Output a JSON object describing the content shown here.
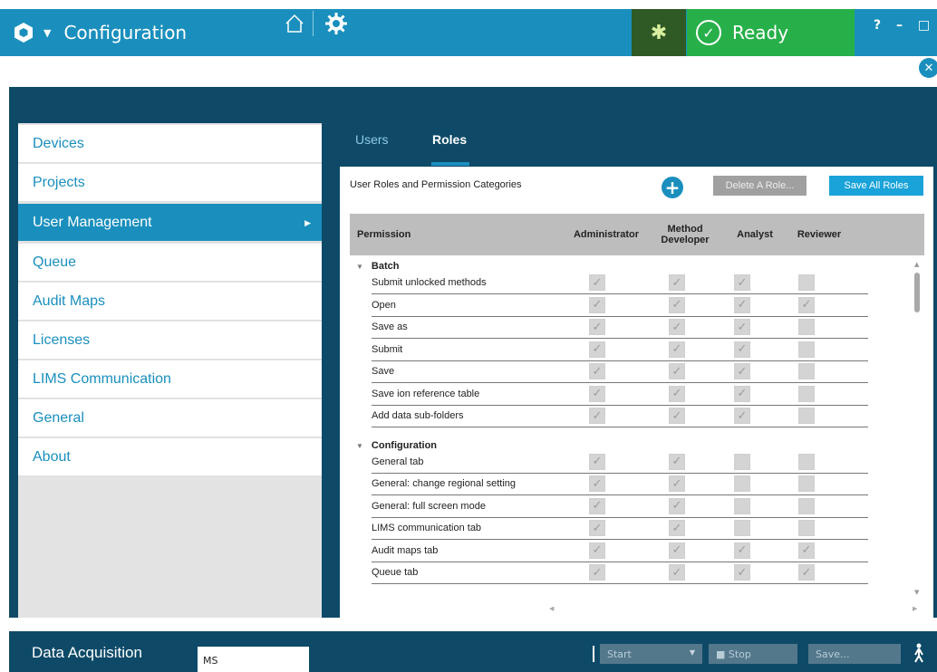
{
  "app": {
    "title": "Configuration",
    "status": "Ready",
    "window_controls": "? – □ ✕"
  },
  "colors": {
    "primary": "#1a8fbd",
    "dark": "#0e4a68",
    "ready": "#27b04a"
  },
  "sidebar": {
    "items": [
      {
        "label": "Devices"
      },
      {
        "label": "Projects"
      },
      {
        "label": "User Management",
        "active": true
      },
      {
        "label": "Queue"
      },
      {
        "label": "Audit Maps"
      },
      {
        "label": "Licenses"
      },
      {
        "label": "LIMS Communication"
      },
      {
        "label": "General"
      },
      {
        "label": "About"
      }
    ]
  },
  "tabs": [
    {
      "label": "Users"
    },
    {
      "label": "Roles",
      "active": true
    }
  ],
  "roles": {
    "title": "User Roles and Permission Categories",
    "add_icon": "plus-circle-icon",
    "delete_label": "Delete A Role...",
    "save_label": "Save All Roles",
    "columns": [
      "Permission",
      "Administrator",
      "Method Developer",
      "Analyst",
      "Reviewer"
    ],
    "groups": [
      {
        "name": "Batch",
        "rows": [
          {
            "label": "Submit unlocked methods",
            "checks": [
              true,
              true,
              true,
              false
            ]
          },
          {
            "label": "Open",
            "checks": [
              true,
              true,
              true,
              true
            ]
          },
          {
            "label": "Save as",
            "checks": [
              true,
              true,
              true,
              false
            ]
          },
          {
            "label": "Submit",
            "checks": [
              true,
              true,
              true,
              false
            ]
          },
          {
            "label": "Save",
            "checks": [
              true,
              true,
              true,
              false
            ]
          },
          {
            "label": "Save ion reference table",
            "checks": [
              true,
              true,
              true,
              false
            ]
          },
          {
            "label": "Add data sub-folders",
            "checks": [
              true,
              true,
              true,
              false
            ]
          }
        ]
      },
      {
        "name": "Configuration",
        "rows": [
          {
            "label": "General tab",
            "checks": [
              true,
              true,
              false,
              false
            ]
          },
          {
            "label": "General: change regional setting",
            "checks": [
              true,
              true,
              false,
              false
            ]
          },
          {
            "label": "General: full screen mode",
            "checks": [
              true,
              true,
              false,
              false
            ]
          },
          {
            "label": "LIMS communication tab",
            "checks": [
              true,
              true,
              false,
              false
            ]
          },
          {
            "label": "Audit maps tab",
            "checks": [
              true,
              true,
              true,
              true
            ]
          },
          {
            "label": "Queue tab",
            "checks": [
              true,
              true,
              true,
              true
            ]
          }
        ]
      }
    ]
  },
  "bottom": {
    "title": "Data Acquisition",
    "input_value": "MS",
    "start_label": "Start",
    "stop_label": "■ Stop",
    "save_label": "Save..."
  }
}
